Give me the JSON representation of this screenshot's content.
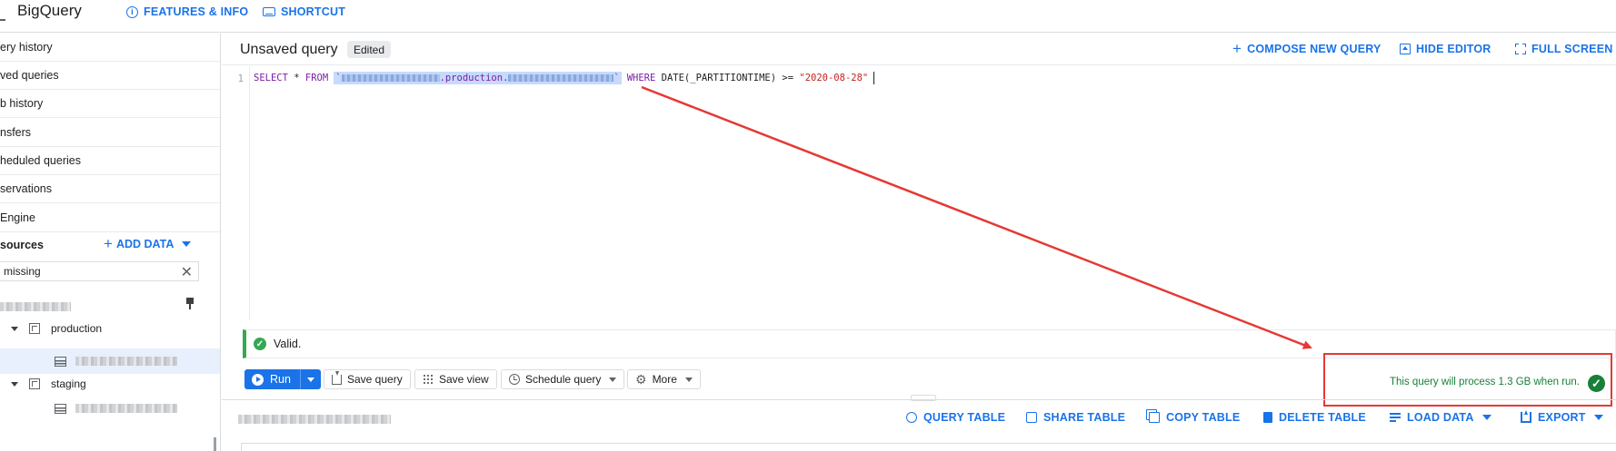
{
  "topbar": {
    "app_title": "BigQuery",
    "features_info": "FEATURES & INFO",
    "shortcut": "SHORTCUT",
    "accent_color": "#1a73e8"
  },
  "sidebar": {
    "items": [
      {
        "label": "ery history"
      },
      {
        "label": "ved queries"
      },
      {
        "label": "b history"
      },
      {
        "label": "nsfers"
      },
      {
        "label": "heduled queries"
      },
      {
        "label": "servations"
      },
      {
        "label": " Engine"
      }
    ],
    "resources_label": "sources",
    "add_data": "ADD DATA",
    "search_value": "missing",
    "tree": {
      "production": "production",
      "staging": "staging"
    }
  },
  "editor": {
    "title": "Unsaved query",
    "edited_chip": "Edited",
    "compose_new_query": "COMPOSE NEW QUERY",
    "hide_editor": "HIDE EDITOR",
    "full_screen": "FULL SCREEN",
    "line_number": "1",
    "code": {
      "kw_select": "SELECT",
      "star": " * ",
      "kw_from": "FROM",
      "dataset_fragment": ".production.",
      "kw_where": "WHERE",
      "condition": " DATE(_PARTITIONTIME) >= ",
      "date_literal": "\"2020-08-28\""
    }
  },
  "validation": {
    "status": "Valid.",
    "process_message": "This query will process 1.3 GB when run.",
    "success_color": "#188038",
    "annotation_color": "#e53935"
  },
  "toolbar": {
    "run": "Run",
    "save_query": "Save query",
    "save_view": "Save view",
    "schedule_query": "Schedule query",
    "more": "More"
  },
  "table_actions": {
    "query_table": "QUERY TABLE",
    "share_table": "SHARE TABLE",
    "copy_table": "COPY TABLE",
    "delete_table": "DELETE TABLE",
    "load_data": "LOAD DATA",
    "export": "EXPORT"
  }
}
